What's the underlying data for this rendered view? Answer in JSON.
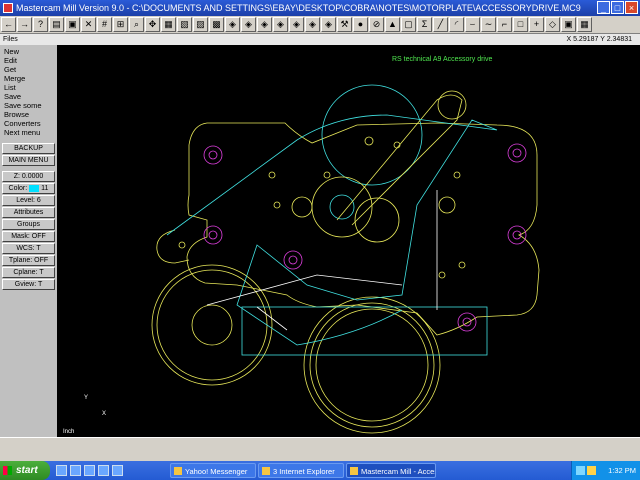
{
  "window": {
    "title": "Mastercam Mill Version 9.0 - C:\\DOCUMENTS AND SETTINGS\\EBAY\\DESKTOP\\COBRA\\NOTES\\MOTORPLATE\\ACCESSORYDRIVE.MC9",
    "minimize": "_",
    "maximize": "□",
    "close": "×"
  },
  "toolbar": {
    "buttons": [
      {
        "name": "back-arrow-icon",
        "glyph": "←"
      },
      {
        "name": "forward-arrow-icon",
        "glyph": "→"
      },
      {
        "name": "help-icon",
        "glyph": "?"
      },
      {
        "name": "print-icon",
        "glyph": "▤"
      },
      {
        "name": "screen-icon",
        "glyph": "▣"
      },
      {
        "name": "delete-icon",
        "glyph": "✕"
      },
      {
        "name": "grid-icon",
        "glyph": "#"
      },
      {
        "name": "measure-icon",
        "glyph": "⊞"
      },
      {
        "name": "zoom-icon",
        "glyph": "⌕"
      },
      {
        "name": "move-icon",
        "glyph": "✥"
      },
      {
        "name": "view-top-icon",
        "glyph": "▦"
      },
      {
        "name": "view-front-icon",
        "glyph": "▧"
      },
      {
        "name": "view-side-icon",
        "glyph": "▨"
      },
      {
        "name": "view-iso-icon",
        "glyph": "▩"
      },
      {
        "name": "cube-1-icon",
        "glyph": "◈"
      },
      {
        "name": "cube-2-icon",
        "glyph": "◈"
      },
      {
        "name": "cube-3-icon",
        "glyph": "◈"
      },
      {
        "name": "cube-4-icon",
        "glyph": "◈"
      },
      {
        "name": "cube-5-icon",
        "glyph": "◈"
      },
      {
        "name": "cube-6-icon",
        "glyph": "◈"
      },
      {
        "name": "cube-7-icon",
        "glyph": "◈"
      },
      {
        "name": "tool-icon",
        "glyph": "⚒"
      },
      {
        "name": "solid-icon",
        "glyph": "●"
      },
      {
        "name": "stop-icon",
        "glyph": "⊘"
      },
      {
        "name": "flag-icon",
        "glyph": "▲"
      },
      {
        "name": "blank-icon",
        "glyph": "▢"
      },
      {
        "name": "sigma-icon",
        "glyph": "Σ"
      },
      {
        "name": "line-icon",
        "glyph": "╱"
      },
      {
        "name": "arc-icon",
        "glyph": "◜"
      },
      {
        "name": "curve-icon",
        "glyph": "⌣"
      },
      {
        "name": "spline-icon",
        "glyph": "∼"
      },
      {
        "name": "poly-icon",
        "glyph": "⌐"
      },
      {
        "name": "rectangle-icon",
        "glyph": "□"
      },
      {
        "name": "point-icon",
        "glyph": "+"
      },
      {
        "name": "eraser-icon",
        "glyph": "◇"
      },
      {
        "name": "cube-8-icon",
        "glyph": "▣"
      },
      {
        "name": "settings-icon",
        "glyph": "▦"
      }
    ]
  },
  "prompt": {
    "left": "Files",
    "coords": "X 5.29187  Y 2.34831"
  },
  "menu": {
    "items": [
      "New",
      "Edit",
      "Get",
      "Merge",
      "List",
      "Save",
      "Save some",
      "Browse",
      "Converters",
      "Next menu"
    ],
    "backup": "BACKUP",
    "main_menu": "MAIN MENU",
    "z": "Z: 0.0000",
    "color_label": "Color:",
    "color_value": "11",
    "level": "Level: 6",
    "attributes": "Attributes",
    "groups": "Groups",
    "mask": "Mask: OFF",
    "wcs": "WCS: T",
    "tplane": "Tplane: OFF",
    "cplane": "Cplane: T",
    "gview": "Gview: T"
  },
  "canvas": {
    "annotation": "RS technical A9 Accessory drive",
    "axis_y": "Y",
    "axis_x": "X",
    "units": "Inch",
    "colors": {
      "background": "#000000",
      "yellow": "#e8e85a",
      "cyan": "#40e0e0",
      "magenta": "#e040e0",
      "green": "#50e850",
      "white": "#ffffff"
    }
  },
  "taskbar": {
    "start": "start",
    "tasks": [
      "Yahoo! Messenger",
      "3 Internet Explorer",
      "Mastercam Mill - Acces..."
    ],
    "clock": "1:32 PM"
  }
}
